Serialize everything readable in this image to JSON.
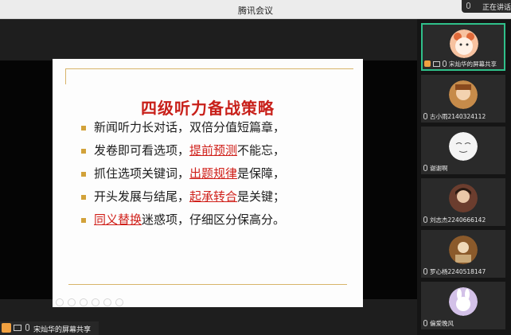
{
  "app": {
    "title": "腾讯会议",
    "speaking_indicator": "正在讲话"
  },
  "slide": {
    "heading": "四级听力备战策略",
    "lines": [
      {
        "pre": "新闻听力长对话，双倍分值短篇章，",
        "hl": "",
        "post": ""
      },
      {
        "pre": "发卷即可看选项，",
        "hl": "提前预测",
        "post": "不能忘，"
      },
      {
        "pre": "抓住选项关键词，",
        "hl": "出题规律",
        "post": "是保障，"
      },
      {
        "pre": "开头发展与结尾，",
        "hl": "起承转合",
        "post": "是关键；"
      },
      {
        "pre": "",
        "hl": "同义替换",
        "post": "迷惑项，仔细区分保高分。"
      }
    ]
  },
  "share_label": "宋灿华的屏幕共享",
  "participants": [
    {
      "name": "宋灿华的屏幕共享",
      "avatar": "cartoon-bear-avatar",
      "color": "#f2a97c",
      "active": true
    },
    {
      "name": "古小雨2140324112",
      "avatar": "illustration-avatar",
      "color": "#c68b4a",
      "active": false
    },
    {
      "name": "谢谢啊",
      "avatar": "sketch-face-avatar",
      "color": "#f1f1f1",
      "active": false
    },
    {
      "name": "刘志杰2240666142",
      "avatar": "portrait-avatar",
      "color": "#6b3d2e",
      "active": false
    },
    {
      "name": "罗心杨2240518147",
      "avatar": "photo-avatar",
      "color": "#8b5a2b",
      "active": false
    },
    {
      "name": "偏爱晚风",
      "avatar": "bunny-avatar",
      "color": "#d3c1e8",
      "active": false
    }
  ]
}
